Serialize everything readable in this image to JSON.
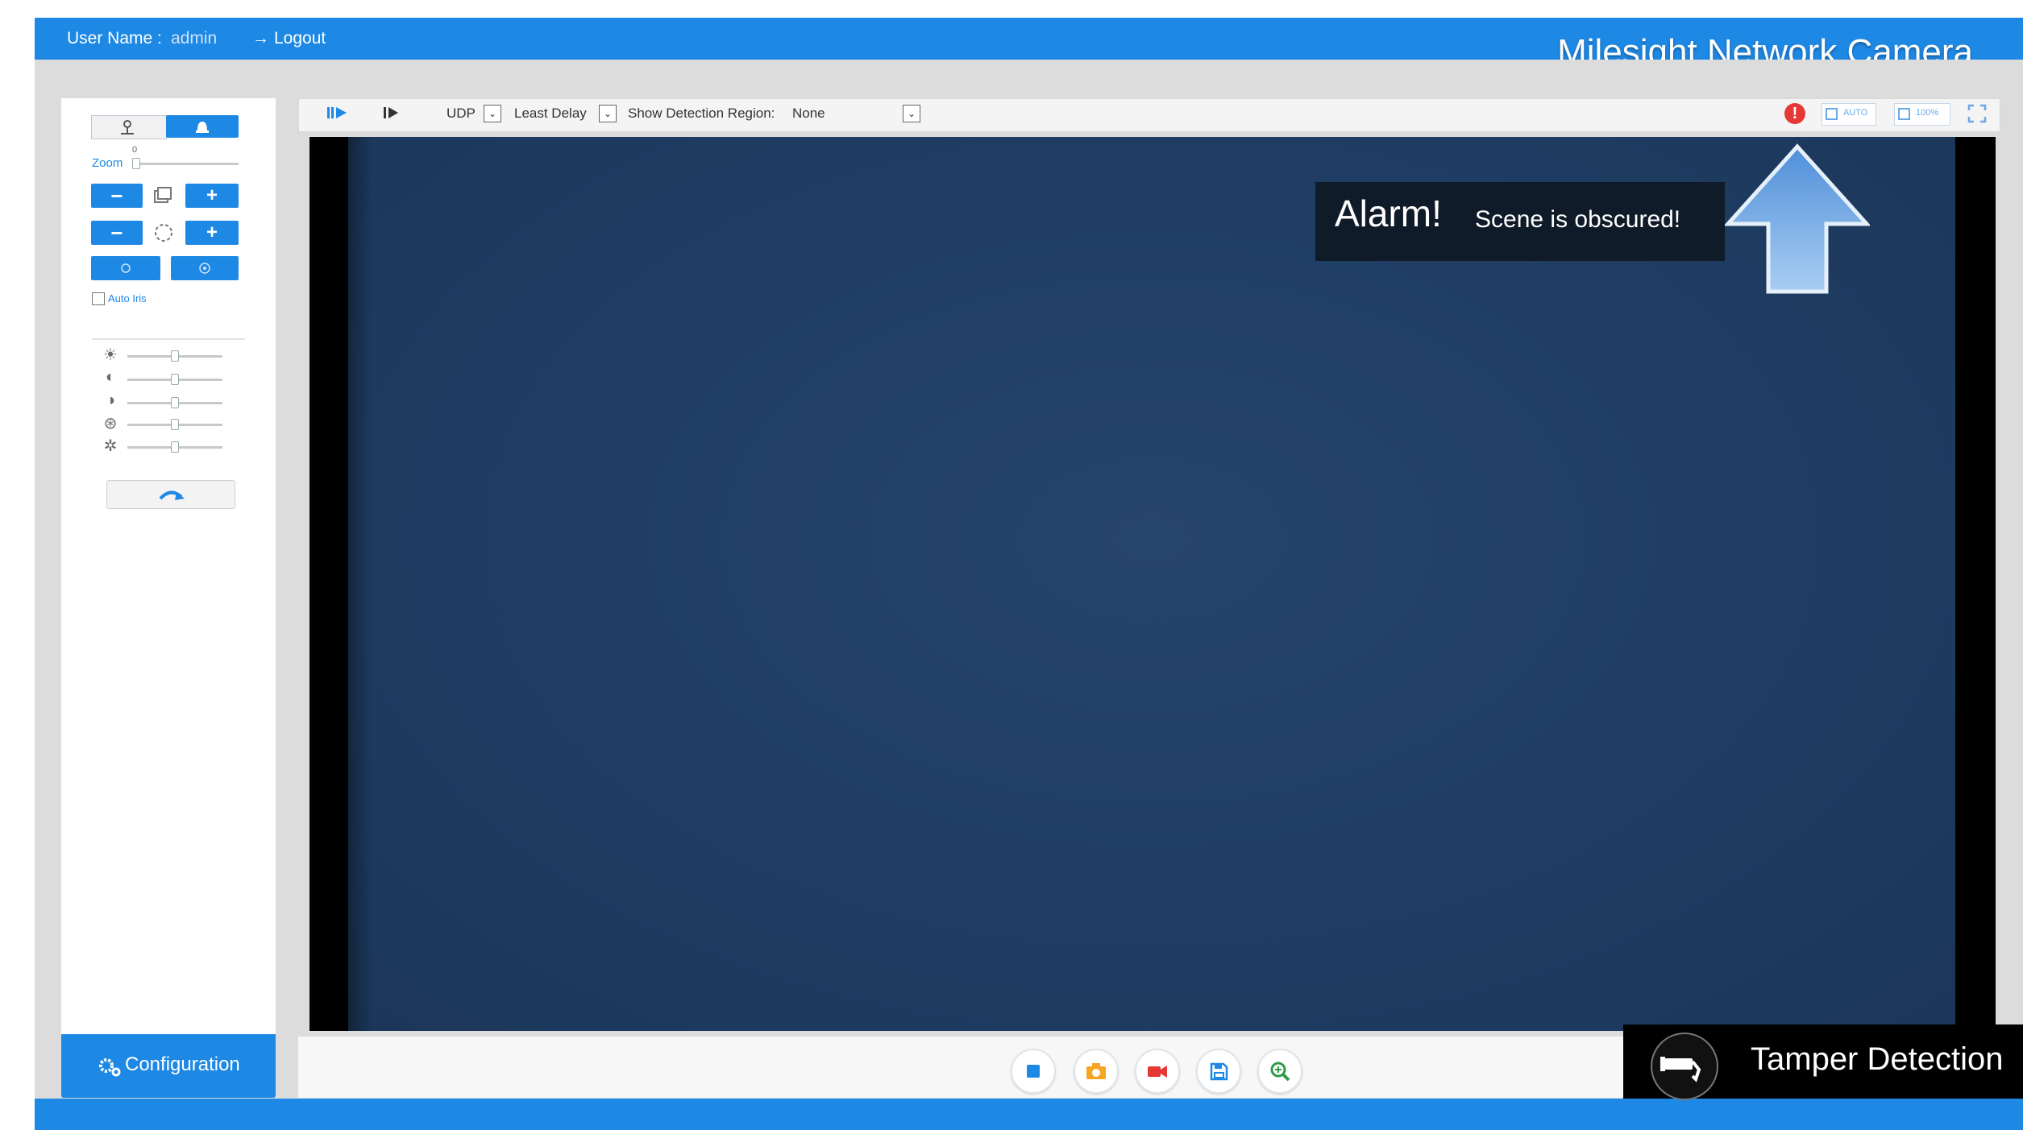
{
  "header": {
    "user_label": "User Name :",
    "user_name": "admin",
    "logout_label": "Logout",
    "logout_arrow": "→",
    "brand": "Milesight Network Camera"
  },
  "left_panel": {
    "zoom_label": "Zoom",
    "zoom_value": "0",
    "minus": "−",
    "plus": "+",
    "auto_iris_label": "Auto Iris",
    "auto_iris_checked": false,
    "sliders": [
      {
        "icon": "brightness-icon",
        "value": 0.5
      },
      {
        "icon": "contrast-icon",
        "value": 0.5
      },
      {
        "icon": "saturation-icon",
        "value": 0.5
      },
      {
        "icon": "sharpness-icon",
        "value": 0.5
      },
      {
        "icon": "noise-icon",
        "value": 0.5
      }
    ],
    "configuration_label": "Configuration"
  },
  "toolbar": {
    "protocol": "UDP",
    "delay": "Least Delay",
    "detection_region_label": "Show Detection Region:",
    "detection_region_value": "None",
    "auto_label": "AUTO",
    "percent_label": "100%"
  },
  "alarm": {
    "title": "Alarm!",
    "message": "Scene is obscured!"
  },
  "tamper": {
    "label": "Tamper Detection"
  },
  "colors": {
    "primary": "#1e88e5",
    "alarm_red": "#e53935",
    "video_bg": "#1f3d63"
  }
}
